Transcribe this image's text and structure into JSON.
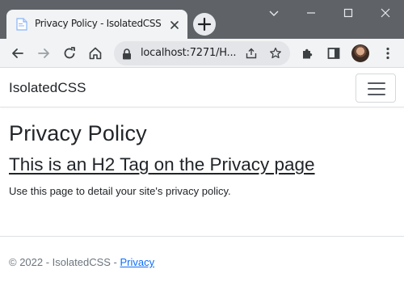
{
  "browser": {
    "tab": {
      "title": "Privacy Policy - IsolatedCSS",
      "favicon": "page-icon",
      "close_icon": "close-icon"
    },
    "new_tab_icon": "plus-icon",
    "window_controls": [
      "chevron-down-icon",
      "minimize-icon",
      "maximize-icon",
      "close-icon"
    ],
    "toolbar": {
      "back_icon": "arrow-left-icon",
      "forward_icon": "arrow-right-icon",
      "reload_icon": "reload-icon",
      "home_icon": "home-icon",
      "address": "localhost:7271/H...",
      "lock_icon": "lock-icon",
      "share_icon": "share-icon",
      "star_icon": "star-icon",
      "extensions_icon": "puzzle-icon",
      "sidepanel_icon": "sidepanel-icon",
      "menu_icon": "kebab-menu-icon"
    }
  },
  "navbar": {
    "brand": "IsolatedCSS",
    "toggler_icon": "hamburger-icon"
  },
  "main": {
    "heading": "Privacy Policy",
    "subheading": "This is an H2 Tag on the Privacy page",
    "text": "Use this page to detail your site's privacy policy."
  },
  "footer": {
    "copyright": "© 2022 - IsolatedCSS - ",
    "link": "Privacy"
  },
  "colors": {
    "tabstrip": "#5f6368",
    "toolbar": "#f1f3f4",
    "text": "#212529",
    "link": "#0d6efd",
    "muted": "#6c757d"
  }
}
